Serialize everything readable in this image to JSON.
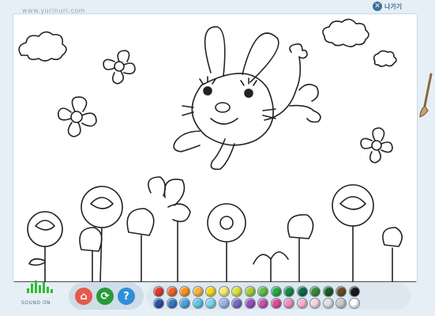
{
  "header": {
    "site_url": "www.yurinuri.com",
    "exit_label": "나가기",
    "exit_icon": "close-circle-icon"
  },
  "sound": {
    "label": "SOUND ON",
    "state": "on"
  },
  "tools": [
    {
      "name": "eraser-button",
      "icon": "eraser-icon",
      "color": "#e25a4a",
      "glyph": "⌂"
    },
    {
      "name": "refresh-button",
      "icon": "refresh-icon",
      "color": "#2a9a3a",
      "glyph": "⟳"
    },
    {
      "name": "help-button",
      "icon": "question-icon",
      "color": "#2f8fd6",
      "glyph": "?"
    }
  ],
  "palette": {
    "row1": [
      "#e23b2e",
      "#f05f2a",
      "#f7941d",
      "#fbb040",
      "#f6d91a",
      "#f3ec6b",
      "#dbe23a",
      "#a6ce39",
      "#63bc46",
      "#2aa84a",
      "#17894a",
      "#0d6b4a",
      "#3c8a3c",
      "#1b5e20",
      "#6b4a2a",
      "#1a1a1a"
    ],
    "row2": [
      "#2f4fa8",
      "#3b78c4",
      "#4aa3df",
      "#5ec7e8",
      "#7fd3f1",
      "#9bb4e0",
      "#7a6bbd",
      "#9b4dbb",
      "#c455b0",
      "#e04c9a",
      "#f08cb8",
      "#f4b3cf",
      "#f7d2e0",
      "#e0e0e0",
      "#c8c8c8",
      "#ffffff"
    ]
  }
}
